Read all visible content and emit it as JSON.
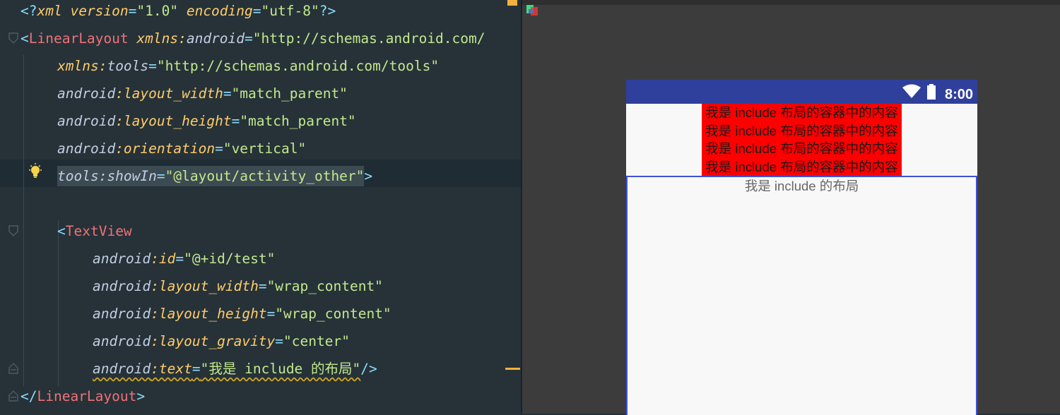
{
  "editor": {
    "lines": [
      [
        "<?",
        "xml",
        " version",
        "=",
        "\"1.0\"",
        " encoding",
        "=",
        "\"utf-8\"",
        "?>"
      ],
      [
        "<",
        "LinearLayout",
        " ",
        "xmlns:",
        "android",
        "=",
        "\"http://schemas.android.com/"
      ],
      [
        "xmlns:",
        "tools",
        "=",
        "\"http://schemas.android.com/tools\""
      ],
      [
        "android",
        ":layout_width",
        "=",
        "\"match_parent\""
      ],
      [
        "android",
        ":layout_height",
        "=",
        "\"match_parent\""
      ],
      [
        "android",
        ":orientation",
        "=",
        "\"vertical\""
      ],
      [
        "tools:showIn",
        "=",
        "\"@layout/activity_other\"",
        ">"
      ],
      [],
      [
        "<",
        "TextView"
      ],
      [
        "android",
        ":id",
        "=",
        "\"@+id/test\""
      ],
      [
        "android",
        ":layout_width",
        "=",
        "\"wrap_content\""
      ],
      [
        "android",
        ":layout_height",
        "=",
        "\"wrap_content\""
      ],
      [
        "android",
        ":layout_gravity",
        "=",
        "\"center\""
      ],
      [
        "android",
        ":text",
        "=",
        "\"我是 include 的布局\"",
        "/>"
      ],
      [
        "</",
        "LinearLayout",
        ">"
      ]
    ]
  },
  "preview": {
    "status_time": "8:00",
    "red_lines": [
      "我是 include 布局的容器中的内容",
      "我是 include 布局的容器中的内容",
      "我是 include 布局的容器中的内容",
      "我是 include 布局的容器中的内容"
    ],
    "include_text": "我是 include 的布局"
  },
  "colors": {
    "editor_bg": "#263238",
    "preview_bg": "#3c3c3c",
    "status_bar": "#2f3f9c",
    "red_block": "#ff0000",
    "include_border": "#3f51d6"
  },
  "icons": [
    "fold-icon",
    "lightbulb-icon",
    "wifi-icon",
    "battery-icon",
    "layout-tool-icon"
  ]
}
